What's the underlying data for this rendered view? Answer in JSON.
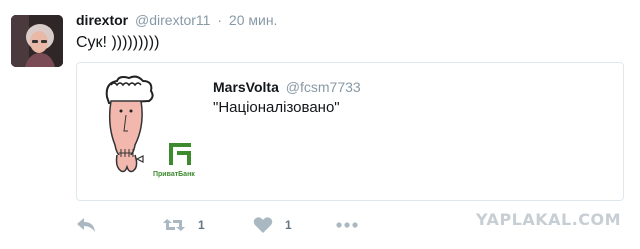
{
  "tweet": {
    "author_name": "dirextor",
    "author_handle": "@dirextor11",
    "separator": "·",
    "time": "20 мин.",
    "text": "Сук! )))))))))"
  },
  "quoted": {
    "author_name": "MarsVolta",
    "author_handle": "@fcsm7733",
    "text": "\"Націоналізовано\"",
    "logo_text": "ПриватБанк"
  },
  "actions": {
    "reply_icon": "reply-icon",
    "retweet_icon": "retweet-icon",
    "retweet_count": "1",
    "like_icon": "heart-icon",
    "like_count": "1",
    "more_icon": "more-dots-icon"
  },
  "watermark": "YAPLAKAL.COM",
  "colors": {
    "text": "#14171a",
    "muted": "#8899a6",
    "action": "#aab8c2",
    "border": "#e1e8ed",
    "privat_green": "#3e8a2f"
  }
}
